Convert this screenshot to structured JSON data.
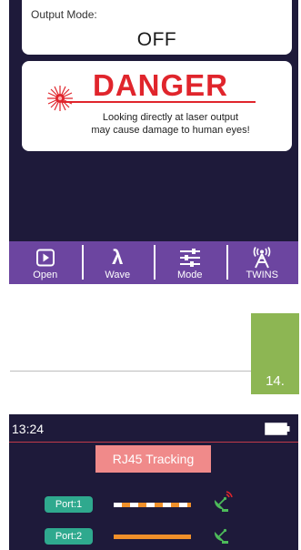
{
  "top_screen": {
    "output_mode_label": "Output Mode:",
    "output_mode_value": "OFF",
    "danger_title": "DANGER",
    "danger_line1": "Looking directly at laser output",
    "danger_line2": "may cause damage to human eyes!",
    "toolbar": [
      {
        "label": "Open",
        "icon": "play-square-icon"
      },
      {
        "label": "Wave",
        "icon": "lambda-icon",
        "glyph": "λ"
      },
      {
        "label": "Mode",
        "icon": "sliders-icon"
      },
      {
        "label": "TWINS",
        "icon": "antenna-icon"
      }
    ]
  },
  "page_number": "14.",
  "bottom_screen": {
    "time": "13:24",
    "title": "RJ45 Tracking",
    "ports": [
      {
        "label": "Port:1",
        "cable": "dashed"
      },
      {
        "label": "Port:2",
        "cable": "solid"
      }
    ]
  },
  "colors": {
    "screen_bg": "#1e1a3a",
    "toolbar": "#6c45a0",
    "danger_red": "#e0252c",
    "page_tab": "#8db653",
    "title_pink": "#f08a8a",
    "port_teal": "#2fa98e",
    "cable_orange": "#f0902a"
  }
}
